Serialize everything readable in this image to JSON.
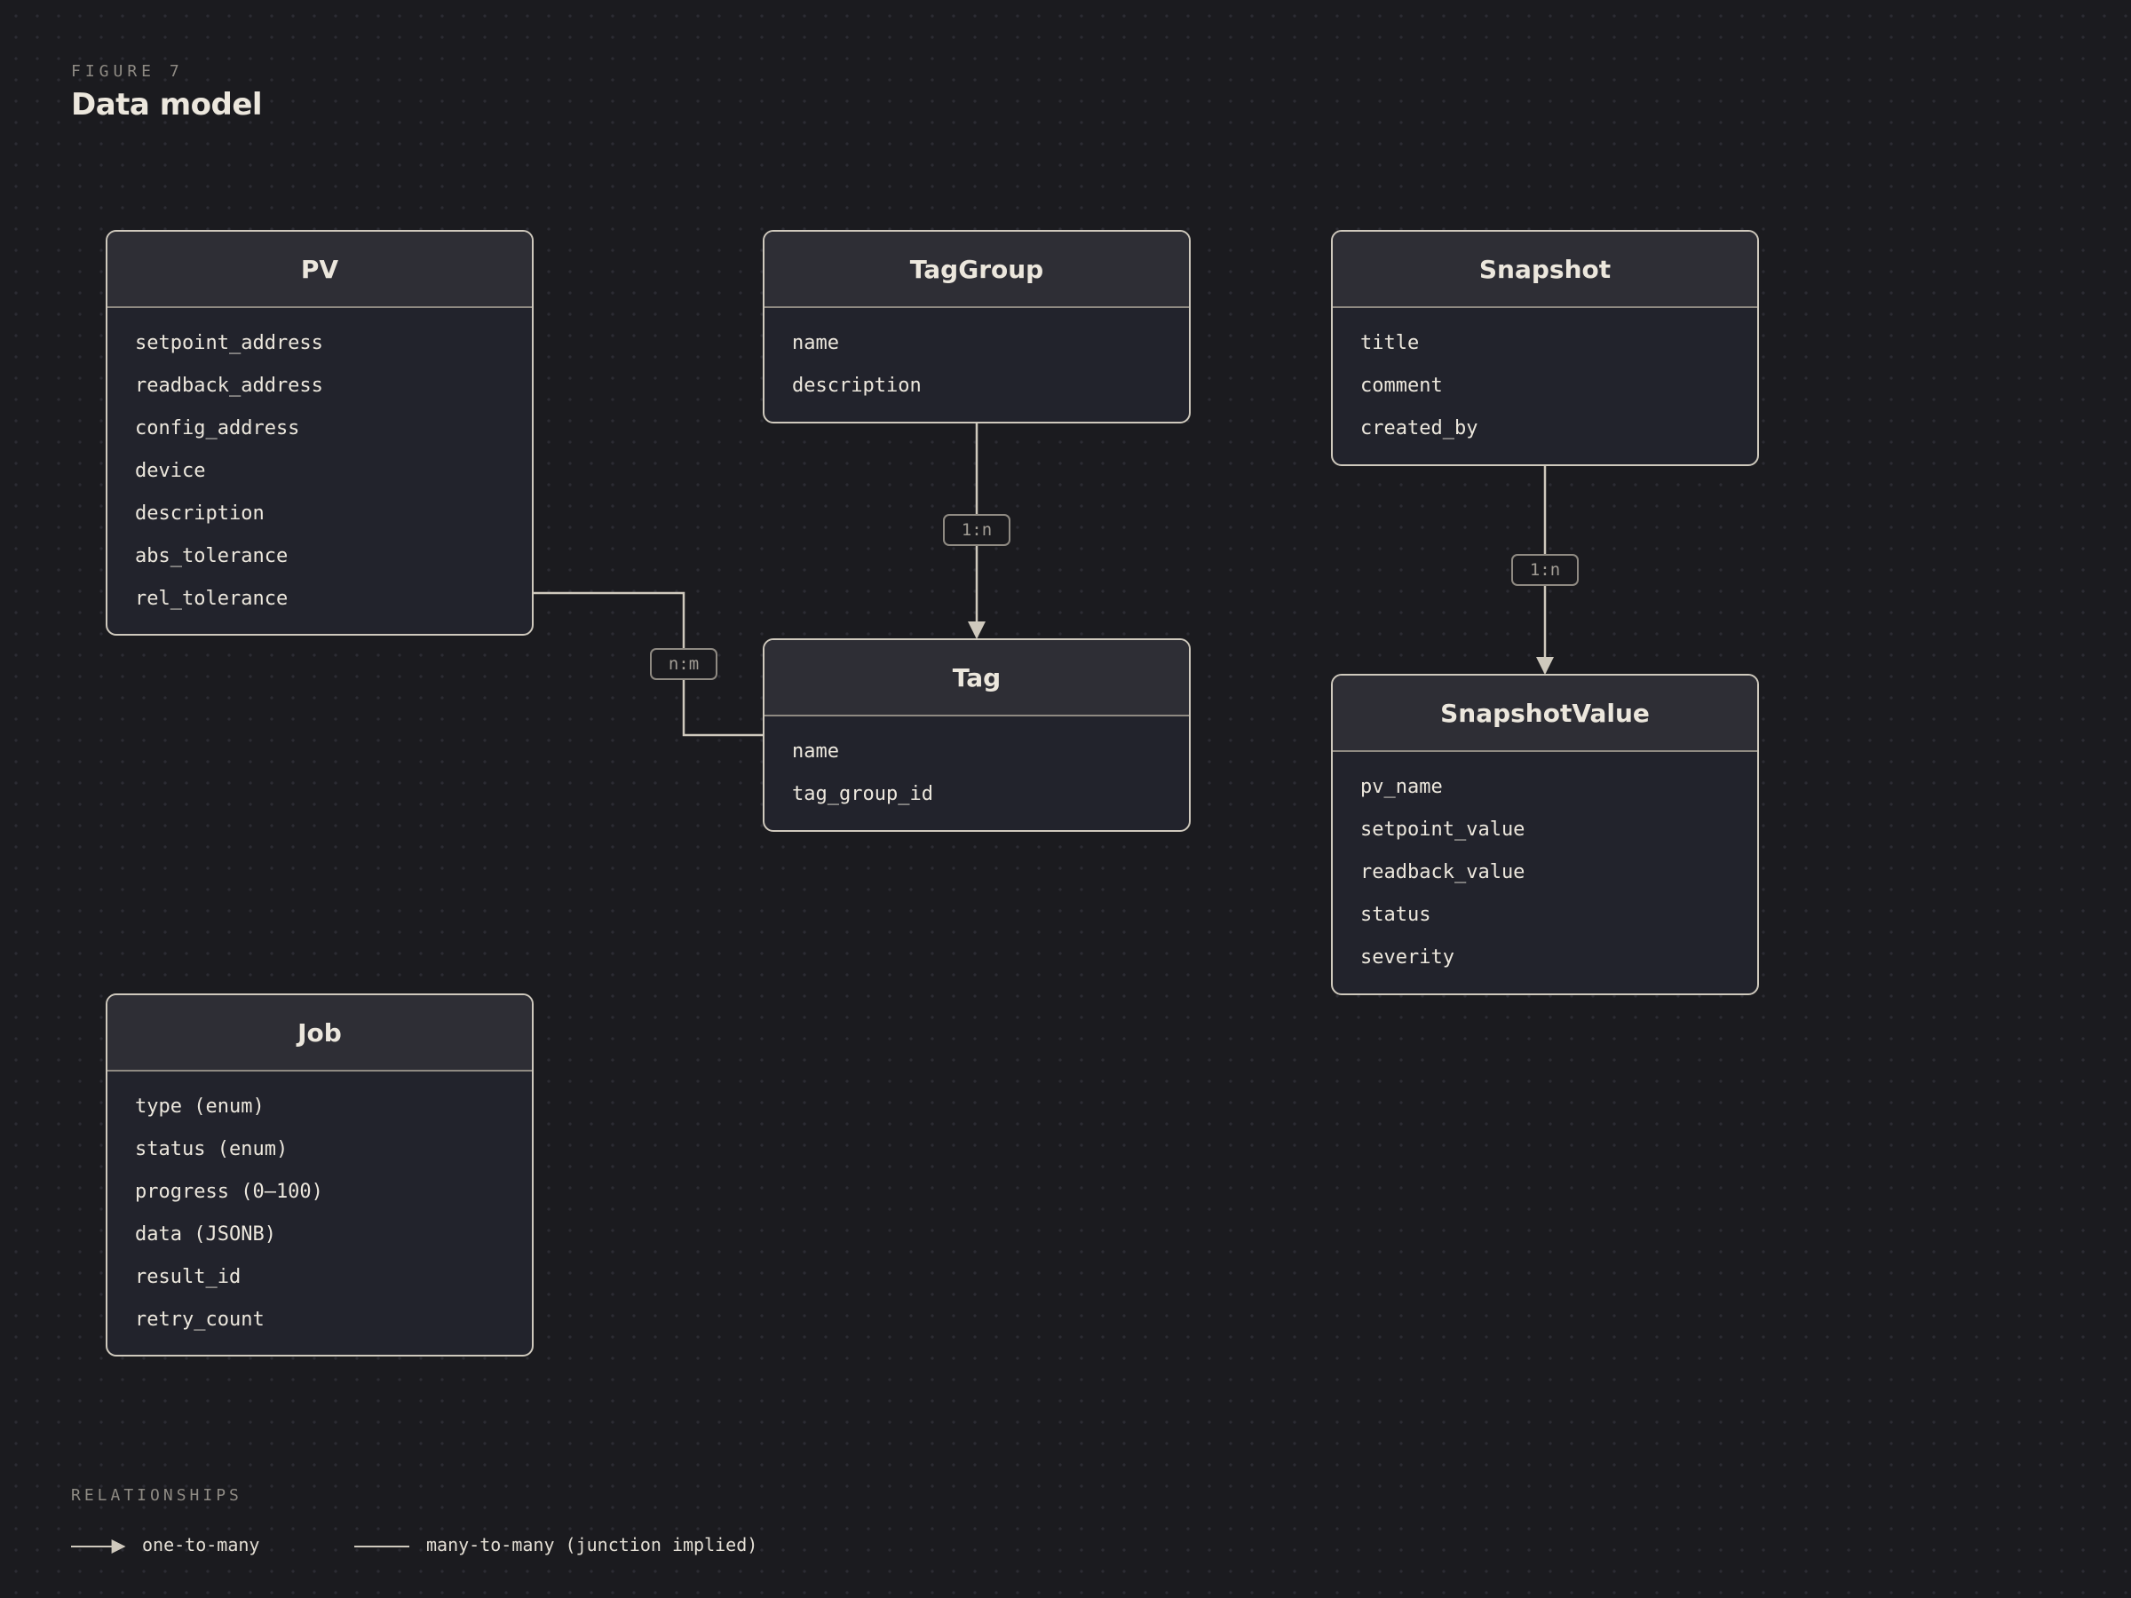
{
  "figure": {
    "kicker": "FIGURE 7",
    "title": "Data model"
  },
  "entities": {
    "pv": {
      "name": "PV",
      "fields": [
        "setpoint_address",
        "readback_address",
        "config_address",
        "device",
        "description",
        "abs_tolerance",
        "rel_tolerance"
      ]
    },
    "taggroup": {
      "name": "TagGroup",
      "fields": [
        "name",
        "description"
      ]
    },
    "snapshot": {
      "name": "Snapshot",
      "fields": [
        "title",
        "comment",
        "created_by"
      ]
    },
    "tag": {
      "name": "Tag",
      "fields": [
        "name",
        "tag_group_id"
      ]
    },
    "snapshotvalue": {
      "name": "SnapshotValue",
      "fields": [
        "pv_name",
        "setpoint_value",
        "readback_value",
        "status",
        "severity"
      ]
    },
    "job": {
      "name": "Job",
      "fields": [
        "type (enum)",
        "status (enum)",
        "progress (0–100)",
        "data (JSONB)",
        "result_id",
        "retry_count"
      ]
    }
  },
  "relationships": {
    "taggroup_tag": "1:n",
    "snapshot_snapshotvalue": "1:n",
    "pv_tag": "n:m"
  },
  "legend": {
    "title": "RELATIONSHIPS",
    "one_to_many": "one-to-many",
    "many_to_many": "many-to-many (junction implied)"
  },
  "colors": {
    "background": "#1b1b1f",
    "entity_fill": "#22232c",
    "entity_header": "#2e2e35",
    "entity_border": "#cfc9bd",
    "connector": "#cfc9bd",
    "muted_text": "#8f8b84",
    "text": "#ece7dd"
  }
}
